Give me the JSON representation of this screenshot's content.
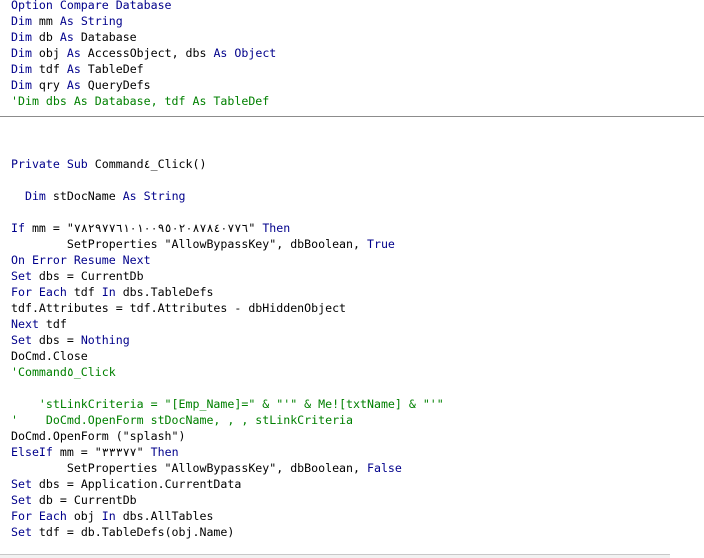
{
  "colors": {
    "keyword": "#00008b",
    "comment": "#008000",
    "text": "#000000",
    "background": "#ffffff",
    "divider": "#8c8c8c"
  },
  "declarations": [
    [
      {
        "t": "kw",
        "s": "Option Compare Database"
      }
    ],
    [
      {
        "t": "kw",
        "s": "Dim"
      },
      {
        "t": "tx",
        "s": " mm "
      },
      {
        "t": "kw",
        "s": "As String"
      }
    ],
    [
      {
        "t": "kw",
        "s": "Dim"
      },
      {
        "t": "tx",
        "s": " db "
      },
      {
        "t": "kw",
        "s": "As"
      },
      {
        "t": "tx",
        "s": " Database"
      }
    ],
    [
      {
        "t": "kw",
        "s": "Dim"
      },
      {
        "t": "tx",
        "s": " obj "
      },
      {
        "t": "kw",
        "s": "As"
      },
      {
        "t": "tx",
        "s": " AccessObject, dbs "
      },
      {
        "t": "kw",
        "s": "As Object"
      }
    ],
    [
      {
        "t": "kw",
        "s": "Dim"
      },
      {
        "t": "tx",
        "s": " tdf "
      },
      {
        "t": "kw",
        "s": "As"
      },
      {
        "t": "tx",
        "s": " TableDef"
      }
    ],
    [
      {
        "t": "kw",
        "s": "Dim"
      },
      {
        "t": "tx",
        "s": " qry "
      },
      {
        "t": "kw",
        "s": "As"
      },
      {
        "t": "tx",
        "s": " QueryDefs"
      }
    ],
    [
      {
        "t": "cm",
        "s": "'Dim dbs As Database, tdf As TableDef"
      }
    ]
  ],
  "procedure": [
    [],
    [],
    [
      {
        "t": "kw",
        "s": "Private Sub"
      },
      {
        "t": "tx",
        "s": " Command٤_Click()"
      }
    ],
    [],
    [
      {
        "t": "tx",
        "s": "  "
      },
      {
        "t": "kw",
        "s": "Dim"
      },
      {
        "t": "tx",
        "s": " stDocName "
      },
      {
        "t": "kw",
        "s": "As String"
      }
    ],
    [],
    [
      {
        "t": "kw",
        "s": "If"
      },
      {
        "t": "tx",
        "s": " mm = \"٧٨٢٩٧٧٦١٠١٠٠٩٥٠٢٠٨٧٨٤٠٧٧٦\" "
      },
      {
        "t": "kw",
        "s": "Then"
      }
    ],
    [
      {
        "t": "tx",
        "s": "        SetProperties \"AllowBypassKey\", dbBoolean, "
      },
      {
        "t": "kw",
        "s": "True"
      }
    ],
    [
      {
        "t": "kw",
        "s": "On Error Resume Next"
      }
    ],
    [
      {
        "t": "kw",
        "s": "Set"
      },
      {
        "t": "tx",
        "s": " dbs = CurrentDb"
      }
    ],
    [
      {
        "t": "kw",
        "s": "For Each"
      },
      {
        "t": "tx",
        "s": " tdf "
      },
      {
        "t": "kw",
        "s": "In"
      },
      {
        "t": "tx",
        "s": " dbs.TableDefs"
      }
    ],
    [
      {
        "t": "tx",
        "s": "tdf.Attributes = tdf.Attributes - dbHiddenObject"
      }
    ],
    [
      {
        "t": "kw",
        "s": "Next"
      },
      {
        "t": "tx",
        "s": " tdf"
      }
    ],
    [
      {
        "t": "kw",
        "s": "Set"
      },
      {
        "t": "tx",
        "s": " dbs = "
      },
      {
        "t": "kw",
        "s": "Nothing"
      }
    ],
    [
      {
        "t": "tx",
        "s": "DoCmd.Close"
      }
    ],
    [
      {
        "t": "cm",
        "s": "'Command٥_Click"
      }
    ],
    [],
    [
      {
        "t": "tx",
        "s": "    "
      },
      {
        "t": "cm",
        "s": "'stLinkCriteria = \"[Emp_Name]=\" & \"'\" & Me![txtName] & \"'\""
      }
    ],
    [
      {
        "t": "cm",
        "s": "'    DoCmd.OpenForm stDocName, , , stLinkCriteria"
      }
    ],
    [
      {
        "t": "tx",
        "s": "DoCmd.OpenForm (\"splash\")"
      }
    ],
    [
      {
        "t": "kw",
        "s": "ElseIf"
      },
      {
        "t": "tx",
        "s": " mm = \"٣٣٣٧٧\" "
      },
      {
        "t": "kw",
        "s": "Then"
      }
    ],
    [
      {
        "t": "tx",
        "s": "        SetProperties \"AllowBypassKey\", dbBoolean, "
      },
      {
        "t": "kw",
        "s": "False"
      }
    ],
    [
      {
        "t": "kw",
        "s": "Set"
      },
      {
        "t": "tx",
        "s": " dbs = Application.CurrentData"
      }
    ],
    [
      {
        "t": "kw",
        "s": "Set"
      },
      {
        "t": "tx",
        "s": " db = CurrentDb"
      }
    ],
    [
      {
        "t": "kw",
        "s": "For Each"
      },
      {
        "t": "tx",
        "s": " obj "
      },
      {
        "t": "kw",
        "s": "In"
      },
      {
        "t": "tx",
        "s": " dbs.AllTables"
      }
    ],
    [
      {
        "t": "kw",
        "s": "Set"
      },
      {
        "t": "tx",
        "s": " tdf = db.TableDefs(obj.Name)"
      }
    ]
  ]
}
